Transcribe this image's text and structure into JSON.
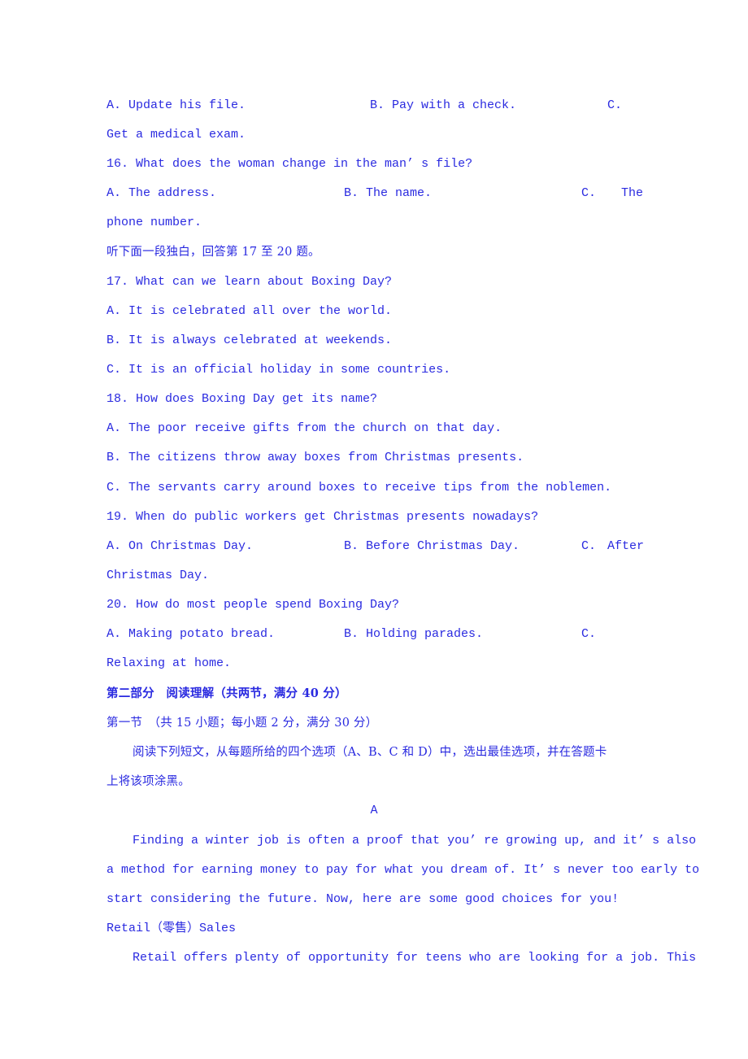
{
  "q15_options": {
    "a": "A. Update his file.",
    "b": "B. Pay with a check.",
    "c": "C.",
    "c_cont": "Get a medical exam."
  },
  "q16": {
    "question": "16. What does the woman change in the man’ s file?",
    "a": "A. The address.",
    "b": "B. The name.",
    "c": "C.",
    "c_word": "The",
    "c_cont": "phone number."
  },
  "monologue_instruction": "听下面一段独白，回答第 17 至 20 题。",
  "q17": {
    "question": "17. What can we learn about Boxing Day?",
    "a": "A. It is celebrated all over the world.",
    "b": "B. It is always celebrated at weekends.",
    "c": "C. It is an official holiday in some countries."
  },
  "q18": {
    "question": "18. How does Boxing Day get its name?",
    "a": "A. The poor receive gifts from the church on that day.",
    "b": "B. The citizens throw away boxes from Christmas presents.",
    "c": "C. The servants carry around boxes to receive tips from the noblemen."
  },
  "q19": {
    "question": "19. When do public workers get Christmas presents nowadays?",
    "a": "A. On Christmas Day.",
    "b": "B. Before Christmas Day.",
    "c": "C.",
    "c_word": "After",
    "c_cont": "Christmas Day."
  },
  "q20": {
    "question": "20. How do most people spend Boxing Day?",
    "a": "A. Making potato bread.",
    "b": "B. Holding parades.",
    "c": "C.",
    "c_cont": "Relaxing at home."
  },
  "part2": {
    "heading": "第二部分　阅读理解（共两节，满分 40 分）",
    "section1": "第一节　（共 15 小题；每小题 2 分，满分 30 分）",
    "instruction_line1": "阅读下列短文，从每题所给的四个选项（A、B、C 和 D）中，选出最佳选项，并在答题卡",
    "instruction_line2": "上将该项涂黑。",
    "passage_label": "A",
    "para1_line1": "Finding a winter job is often a proof that you’ re growing up, and it’ s also",
    "para1_line2": "a method for earning money to pay for what you dream of. It’ s never too early to",
    "para1_line3": "start considering the future. Now, here are some good choices for you!",
    "subheading": "Retail（零售）Sales",
    "para2_line1": "Retail offers plenty of opportunity for teens who are looking for a job. This"
  }
}
